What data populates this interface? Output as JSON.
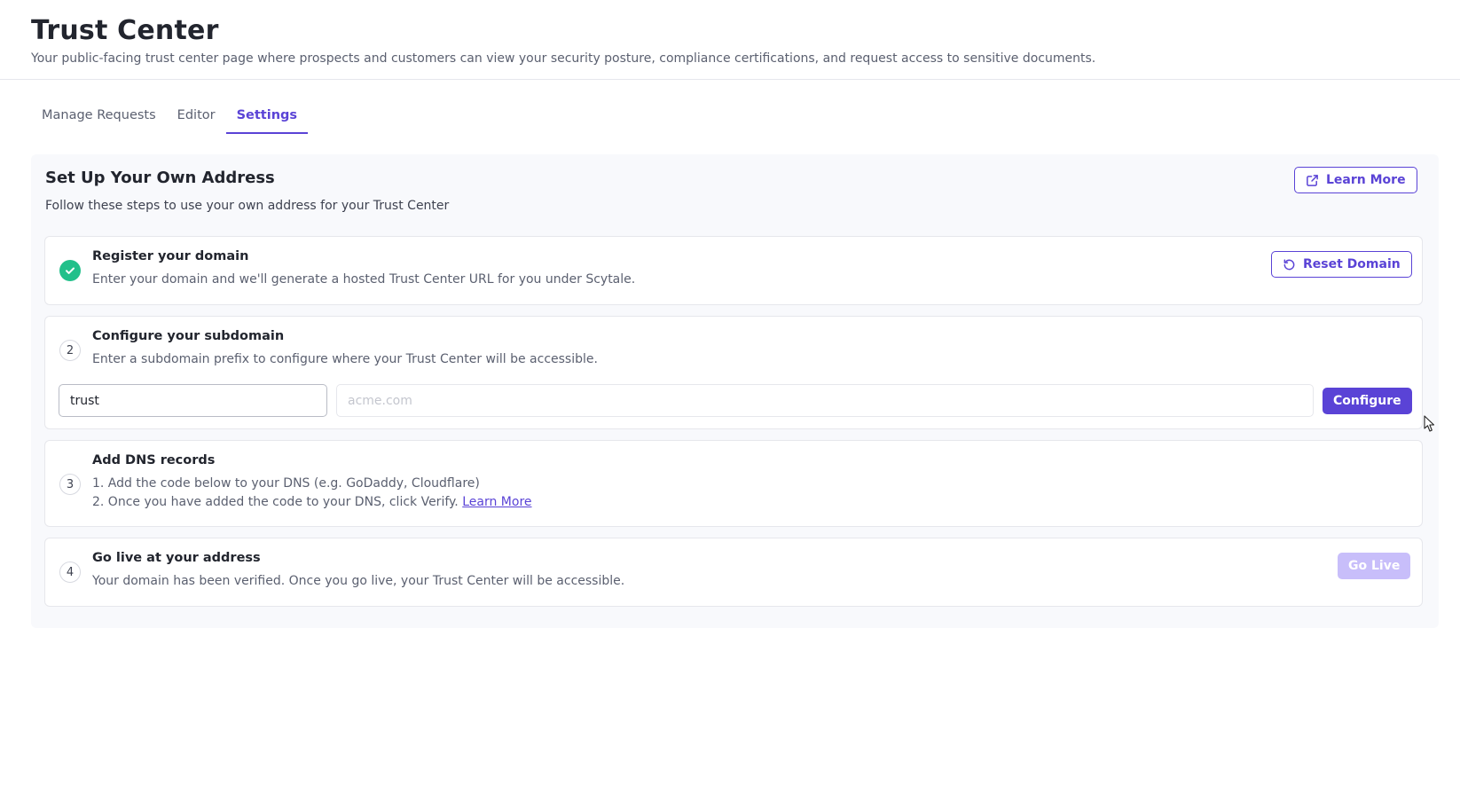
{
  "header": {
    "title": "Trust Center",
    "subtitle": "Your public-facing trust center page where prospects and customers can view your security posture, compliance certifications, and request access to sensitive documents."
  },
  "tabs": [
    {
      "label": "Manage Requests",
      "active": false
    },
    {
      "label": "Editor",
      "active": false
    },
    {
      "label": "Settings",
      "active": true
    }
  ],
  "panel": {
    "title": "Set Up Your Own Address",
    "description": "Follow these steps to use your own address for your Trust Center",
    "learn_more_label": "Learn More",
    "learn_more_icon": "external-link-icon"
  },
  "steps": [
    {
      "status": "complete",
      "icon": "check-icon",
      "title": "Register your domain",
      "description": "Enter your domain and we'll generate a hosted Trust Center URL for you under Scytale.",
      "action_label": "Reset Domain",
      "action_icon": "reset-icon"
    },
    {
      "number": "2",
      "title": "Configure your subdomain",
      "description": "Enter a subdomain prefix to configure where your Trust Center will be accessible.",
      "prefix_value": "trust",
      "domain_placeholder": "acme.com",
      "action_label": "Configure"
    },
    {
      "number": "3",
      "title": "Add DNS records",
      "line1": "1. Add the code below to your DNS (e.g. GoDaddy, Cloudflare)",
      "line2": "2. Once you have added the code to your DNS, click Verify.",
      "link_label": "Learn More"
    },
    {
      "number": "4",
      "title": "Go live at your address",
      "description": "Your domain has been verified. Once you go live, your Trust Center will be accessible.",
      "action_label": "Go Live",
      "action_disabled": true
    }
  ],
  "colors": {
    "accent": "#5a43d6",
    "success": "#22c08a",
    "disabled_button": "#c8befa"
  }
}
